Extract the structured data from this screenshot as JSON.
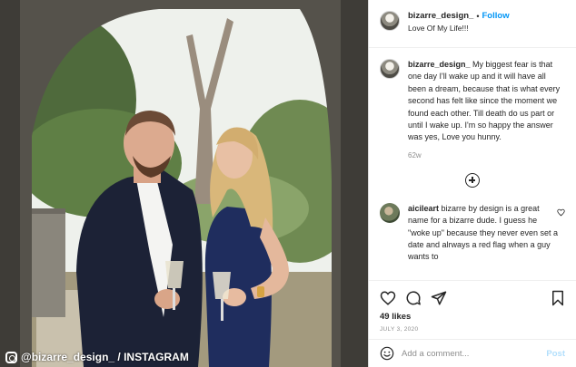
{
  "photo": {
    "watermark": "@bizarre_design_ / INSTAGRAM"
  },
  "post": {
    "username": "bizarre_design_",
    "separator": "•",
    "follow_label": "Follow",
    "subtitle": "Love Of My Life!!!",
    "caption_username": "bizarre_design_",
    "caption_text": "My biggest fear is that one day I'll wake up and it will have all been a dream, because that is what every second has felt like since the moment we found each other. Till death do us part or until I wake up. I'm so happy the answer was yes, Love you hunny.",
    "caption_time": "62w"
  },
  "comments": [
    {
      "username": "aicileart",
      "text": "bizarre by design is a great name for a bizarre dude. I guess he \"woke up\" because they never even set a date and alrways a red flag when a guy wants to"
    }
  ],
  "actions": {
    "likes": "49 likes",
    "date": "JULY 3, 2020"
  },
  "add_comment": {
    "placeholder": "Add a comment...",
    "post_label": "Post"
  },
  "icons": {
    "load_more": "plus-circle-icon",
    "like": "heart-icon",
    "comment": "comment-icon",
    "share": "paper-plane-icon",
    "save": "bookmark-icon",
    "emoji": "smiley-icon",
    "watermark": "instagram-icon"
  }
}
